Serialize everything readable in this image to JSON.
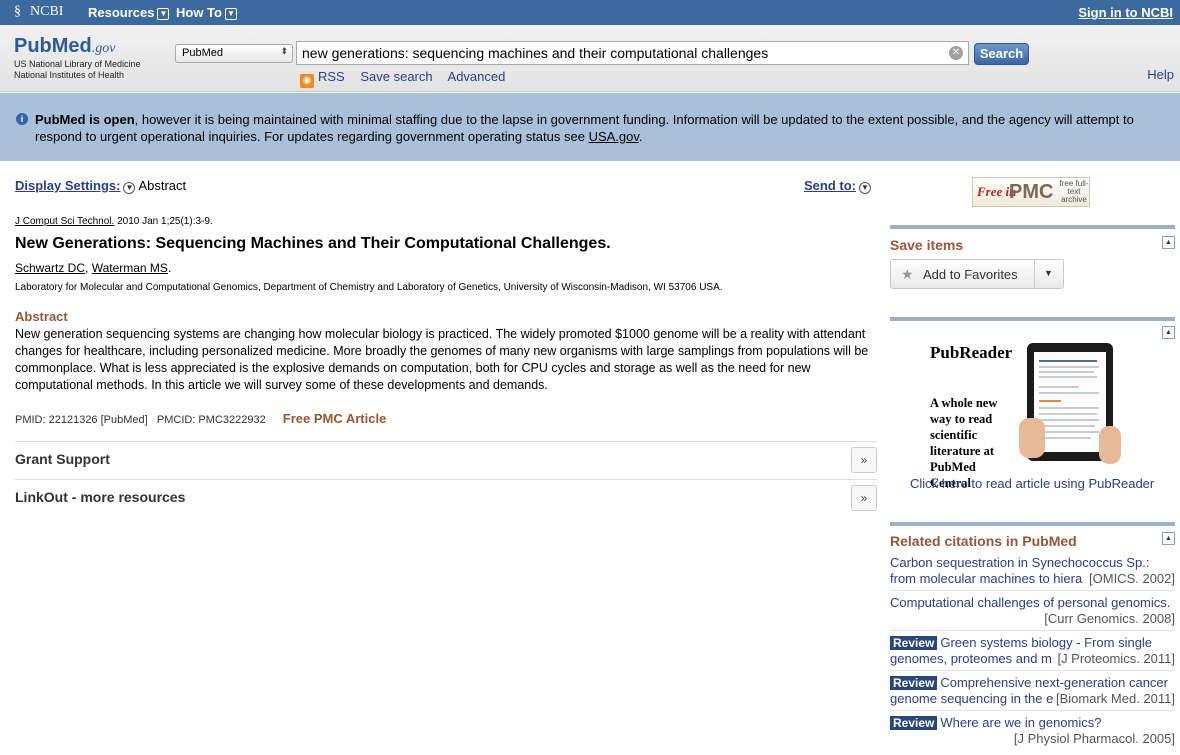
{
  "topbar": {
    "ncbi": "NCBI",
    "resources": "Resources",
    "howto": "How To",
    "signin": "Sign in to NCBI"
  },
  "header": {
    "logo_pub": "PubMed",
    "logo_gov": ".gov",
    "logo_sub1": "US National Library of Medicine",
    "logo_sub2": "National Institutes of Health",
    "db_selected": "PubMed",
    "search_value": "new generations: sequencing machines and their computational challenges",
    "search_button": "Search",
    "rss": "RSS",
    "save_search": "Save search",
    "advanced": "Advanced",
    "help": "Help"
  },
  "notice": {
    "bold": "PubMed is open",
    "text": ", however it is being maintained with minimal staffing due to the lapse in government funding. Information will be updated to the extent possible, and the agency will attempt to respond to urgent operational inquiries. For updates regarding government operating status see ",
    "link": "USA.gov",
    "tail": "."
  },
  "main": {
    "display_settings": "Display Settings:",
    "display_value": "Abstract",
    "send_to": "Send to:",
    "journal": "J Comput Sci Technol.",
    "citation": " 2010 Jan 1;25(1):3-9.",
    "title": "New Generations: Sequencing Machines and Their Computational Challenges.",
    "author1": "Schwartz DC",
    "author2": "Waterman MS",
    "affiliation": "Laboratory for Molecular and Computational Genomics, Department of Chemistry and Laboratory of Genetics, University of Wisconsin-Madison, WI 53706 USA.",
    "abstract_heading": "Abstract",
    "abstract": "New generation sequencing systems are changing how molecular biology is practiced. The widely promoted $1000 genome will be a reality with attendant changes for healthcare, including personalized medicine. More broadly the genomes of many new organisms with large samplings from populations will be commonplace. What is less appreciated is the explosive demands on computation, both for CPU cycles and storage as well as the need for new computational methods. In this article we will survey some of these developments and demands.",
    "pmid": "PMID: 22121326 [PubMed]",
    "pmcid": "PMCID: PMC3222932",
    "free_pmc": "Free PMC Article",
    "grant_support": "Grant Support",
    "linkout": "LinkOut - more resources"
  },
  "right": {
    "pmc_free": "Free in",
    "pmc_text": "PMC",
    "pmc_small": "free full-text archive",
    "save_items": "Save items",
    "add_favorites": "Add to Favorites",
    "pubreader_title": "PubReader",
    "pubreader_text": "A whole new way to read scientific literature at PubMed Central",
    "pubreader_link": "Click here to read article using PubReader",
    "related_heading": "Related citations in PubMed",
    "related": [
      {
        "line1": "Carbon sequestration in Synechococcus Sp.:",
        "line2": "from molecular machines to hiera",
        "source": "[OMICS. 2002]"
      },
      {
        "line1": "Computational challenges of personal genomics.",
        "source": "[Curr Genomics. 2008]"
      },
      {
        "badge": "Review",
        "line1": "Green systems biology - From single",
        "line2": "genomes, proteomes and m",
        "source": "[J Proteomics. 2011]"
      },
      {
        "badge": "Review",
        "line1": "Comprehensive next-generation cancer",
        "line2": "genome sequencing in the e",
        "source": "[Biomark Med. 2011]"
      },
      {
        "badge": "Review",
        "line1": "Where are we in genomics?",
        "source": "[J Physiol Pharmacol. 2005]"
      }
    ]
  }
}
